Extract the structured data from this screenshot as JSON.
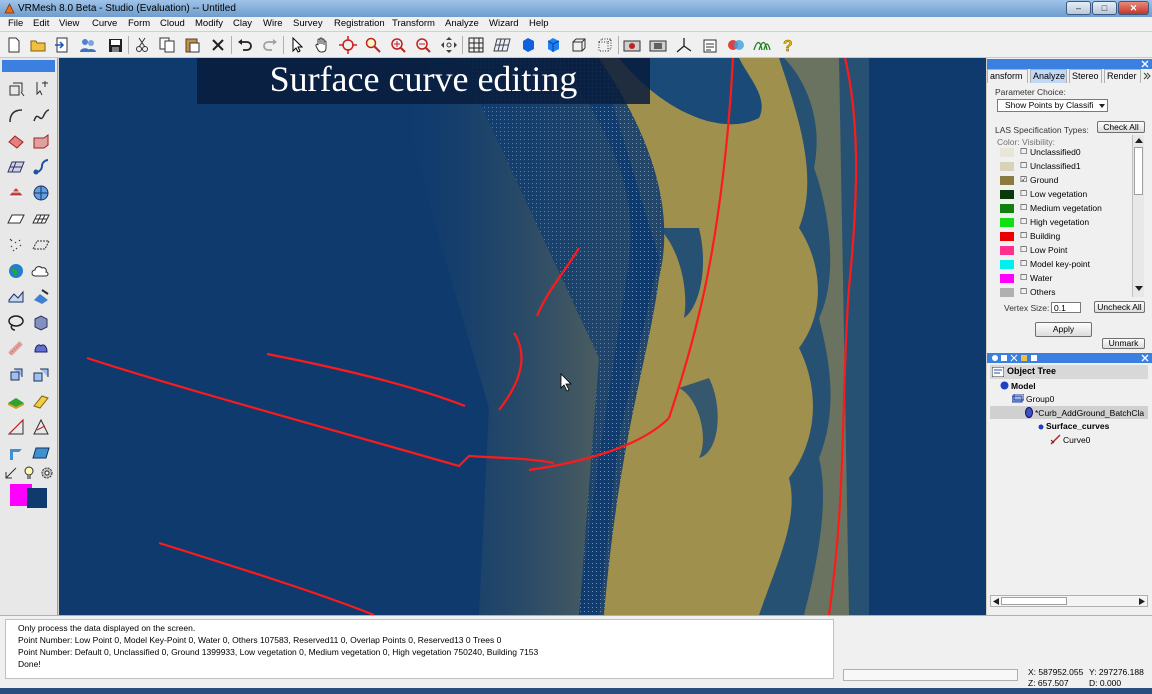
{
  "window": {
    "title": "VRMesh 8.0 Beta - Studio (Evaluation) -- Untitled",
    "minimize": "–",
    "maximize": "□",
    "close": "✕"
  },
  "menu": [
    "File",
    "Edit",
    "View",
    "Curve",
    "Form",
    "Cloud",
    "Modify",
    "Clay",
    "Wire",
    "Survey",
    "Registration",
    "Transform",
    "Analyze",
    "Wizard",
    "Help"
  ],
  "toolbar_icons": [
    "new-icon",
    "open-icon",
    "import-icon",
    "users-icon",
    "save-icon",
    "cut-icon",
    "copy-icon",
    "paste-icon",
    "delete-icon",
    "undo-icon",
    "redo-icon",
    "select-arrow-icon",
    "pan-hand-icon",
    "rotate-icon",
    "zoom-icon",
    "zoom-window-icon",
    "zoom-out-icon",
    "zoom-all-icon",
    "grid-icon",
    "plane-grid-icon",
    "solid-cube-icon",
    "shaded-cube-icon",
    "wire-cube-icon",
    "point-cube-icon",
    "camera-icon",
    "camera2-icon",
    "axis-icon",
    "properties-icon",
    "layers-icon",
    "wave-icon",
    "help-icon"
  ],
  "palette_icons": [
    "cube-select-icon",
    "pick-icon",
    "curve-icon",
    "spline-icon",
    "surface-icon",
    "patch-icon",
    "plane-icon",
    "sweep-icon",
    "mesh-icon",
    "sphere-net-icon",
    "flat-icon",
    "grid-flat-icon",
    "scatter-icon",
    "dotted-plane-icon",
    "globe-icon",
    "cloud-icon",
    "mesh-edit-icon",
    "brush-icon",
    "lasso-icon",
    "shade-icon",
    "bandage-icon",
    "blob-icon",
    "cube-move-icon",
    "cube-copy-icon",
    "terrain-icon",
    "tag-icon",
    "triangle-icon",
    "triangle-outline-icon",
    "split-icon",
    "panel-icon",
    "scale-icon",
    "bulb-icon",
    "gear-icon"
  ],
  "palette_colors": {
    "foreground": "#ff00ff",
    "background": "#0e3a6e"
  },
  "viewport": {
    "overlay_title": "Surface curve editing",
    "colors": {
      "ground": "#a0904e",
      "background": "#0e3a6e",
      "vegetation": "#1a4a78",
      "curve": "#ff1a1a"
    }
  },
  "right_panel": {
    "tabs": [
      {
        "label": "ansform",
        "active": false
      },
      {
        "label": "Analyze",
        "active": true
      },
      {
        "label": "Stereo",
        "active": false
      },
      {
        "label": "Render",
        "active": false
      }
    ],
    "parameter_choice_label": "Parameter Choice:",
    "parameter_choice_value": "Show Points by Classifi",
    "las_label": "LAS Specification Types:",
    "check_all": "Check All",
    "color_visibility": "Color:  Visibility:",
    "classes": [
      {
        "name": "Unclassified0",
        "color": "#e8e6d8",
        "checked": false
      },
      {
        "name": "Unclassified1",
        "color": "#d8d2b8",
        "checked": false
      },
      {
        "name": "Ground",
        "color": "#8a7a40",
        "checked": true
      },
      {
        "name": "Low vegetation",
        "color": "#0a3a0a",
        "checked": false
      },
      {
        "name": "Medium vegetation",
        "color": "#108010",
        "checked": false
      },
      {
        "name": "High vegetation",
        "color": "#10e010",
        "checked": false
      },
      {
        "name": "Building",
        "color": "#e80000",
        "checked": false
      },
      {
        "name": "Low Point",
        "color": "#ff3090",
        "checked": false
      },
      {
        "name": "Model key-point",
        "color": "#00f0f0",
        "checked": false
      },
      {
        "name": "Water",
        "color": "#ff00ff",
        "checked": false
      },
      {
        "name": "Others",
        "color": "#b0b0b0",
        "checked": false
      }
    ],
    "vertex_size_label": "Vertex Size:",
    "vertex_size_value": "0.1",
    "uncheck_all": "Uncheck All",
    "apply": "Apply",
    "unmark": "Unmark",
    "object_tree_title": "Object Tree",
    "tree": [
      {
        "label": "Model",
        "bold": true,
        "icon": "model-sphere-icon"
      },
      {
        "label": "Group0",
        "bold": false,
        "icon": "group-icon"
      },
      {
        "label": "*Curb_AddGround_BatchCla",
        "bold": false,
        "icon": "pointcloud-icon"
      },
      {
        "label": "Surface_curves",
        "bold": true,
        "icon": "dot-icon"
      },
      {
        "label": "Curve0",
        "bold": false,
        "icon": "curve-item-icon"
      }
    ]
  },
  "status": {
    "log": [
      "Only process the data displayed on the screen.",
      "Point Number: Low Point 0, Model Key-Point 0, Water 0, Others 107583, Reserved11 0, Overlap Points 0, Reserved13 0 Trees 0",
      "Point Number: Default 0, Unclassified 0, Ground 1399933, Low vegetation 0, Medium vegetation 0, High vegetation 750240, Building 7153",
      "Done!"
    ],
    "coords": {
      "x": "X: 587952.055",
      "y": "Y: 297276.188",
      "z": "Z: 657.507",
      "d": "D: 0.000"
    }
  }
}
